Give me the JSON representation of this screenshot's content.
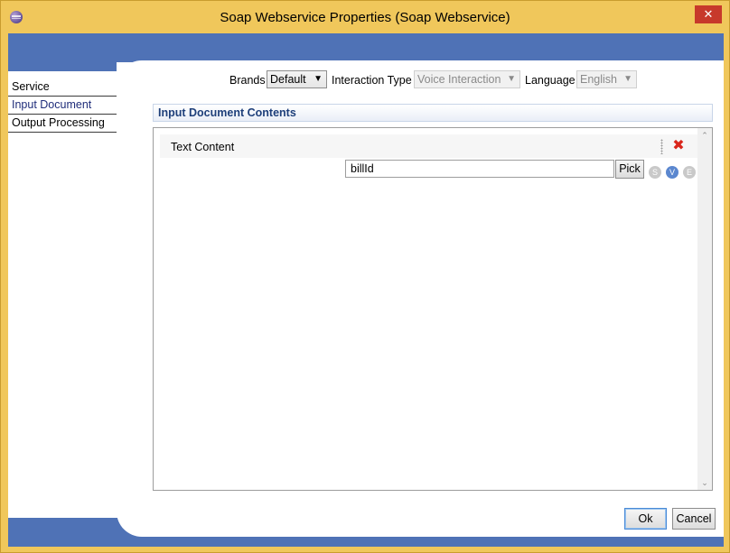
{
  "window": {
    "title": "Soap Webservice Properties (Soap Webservice)",
    "close_glyph": "✕",
    "accent": "#4f72b6",
    "frame_color": "#f0c75b"
  },
  "sidebar": {
    "items": [
      {
        "label": "Service"
      },
      {
        "label": "Input Document",
        "active": true
      },
      {
        "label": "Output Processing"
      }
    ]
  },
  "toolbar": {
    "brands_label": "Brands",
    "brands_value": "Default",
    "interaction_label": "Interaction Type",
    "interaction_value": "Voice Interaction",
    "language_label": "Language",
    "language_value": "English"
  },
  "section": {
    "title": "Input Document Contents"
  },
  "content": {
    "row_label": "Text Content",
    "delete_icon": "delete-x-icon",
    "input_value": "billId",
    "pick_label": "Pick",
    "badges": {
      "s": "S",
      "v": "V",
      "e": "E"
    }
  },
  "buttons": {
    "ok": "Ok",
    "cancel": "Cancel"
  }
}
